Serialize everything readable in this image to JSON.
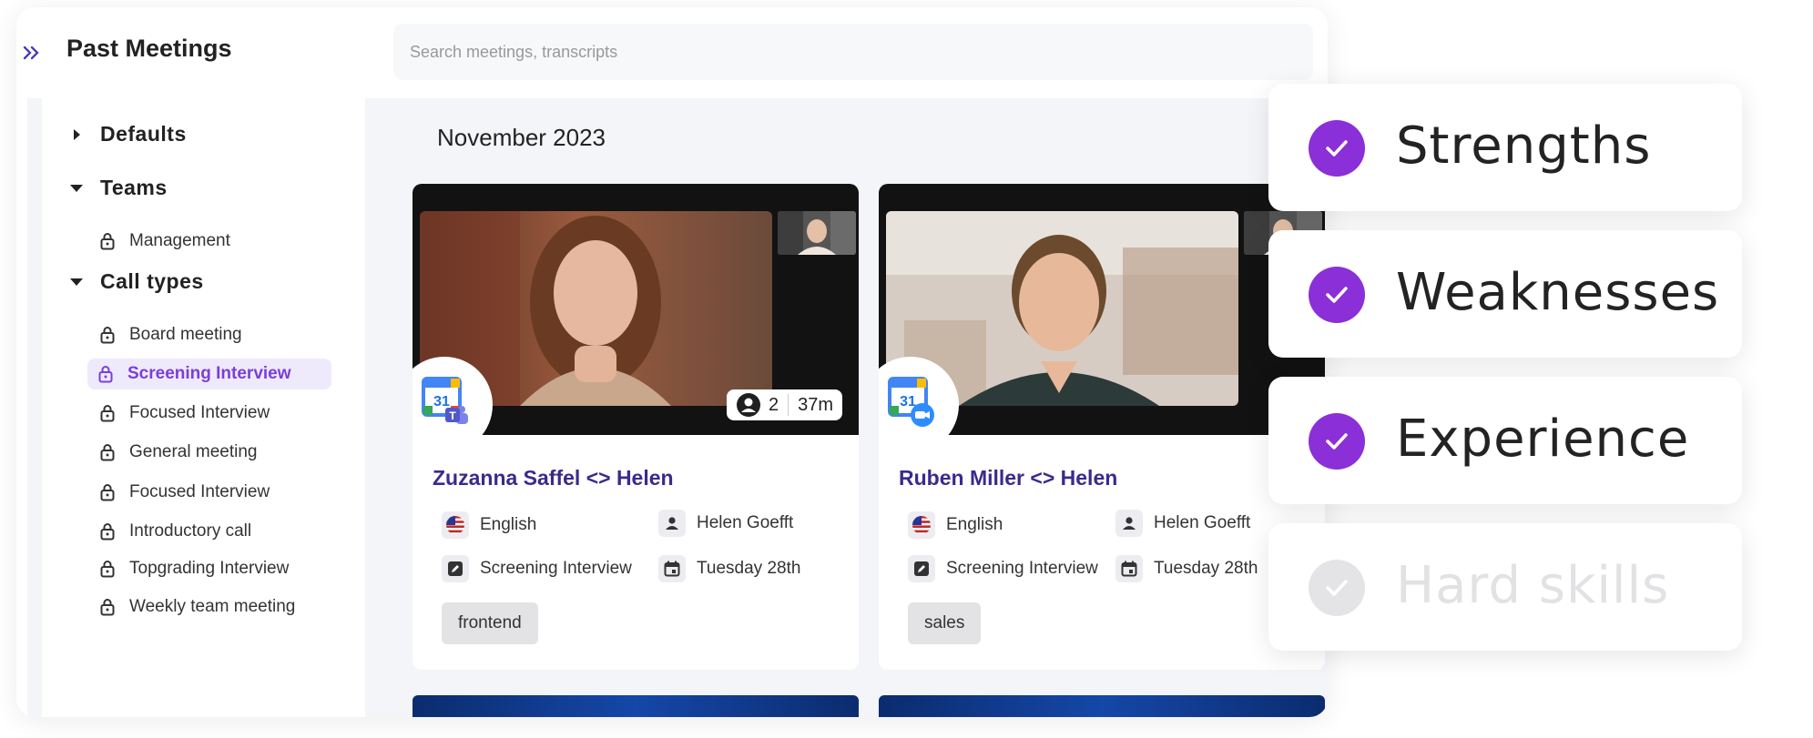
{
  "header": {
    "title": "Past Meetings",
    "search_placeholder": "Search meetings, transcripts"
  },
  "sidebar": {
    "sections": [
      {
        "label": "Defaults",
        "expanded": false
      },
      {
        "label": "Teams",
        "expanded": true
      },
      {
        "label": "Call types",
        "expanded": true
      }
    ],
    "teams_items": [
      "Management"
    ],
    "call_type_items": [
      "Board meeting",
      "Screening Interview",
      "Focused Interview",
      "General meeting",
      "Focused Interview",
      "Introductory call",
      "Topgrading Interview",
      "Weekly team meeting"
    ],
    "active_item": "Screening Interview"
  },
  "main": {
    "month": "November 2023",
    "cards": [
      {
        "title": "Zuzanna Saffel <> Helen",
        "language": "English",
        "host": "Helen Goefft",
        "call_type": "Screening Interview",
        "date": "Tuesday 28th",
        "tag": "frontend",
        "participants": "2",
        "duration": "37m"
      },
      {
        "title": "Ruben Miller <> Helen",
        "language": "English",
        "host": "Helen Goefft",
        "call_type": "Screening Interview",
        "date": "Tuesday 28th",
        "tag": "sales"
      }
    ]
  },
  "features": [
    {
      "label": "Strengths",
      "checked": true
    },
    {
      "label": "Weaknesses",
      "checked": true
    },
    {
      "label": "Experience",
      "checked": true
    },
    {
      "label": "Hard skills",
      "checked": false
    }
  ],
  "colors": {
    "accent": "#8b2fd8",
    "title_purple": "#3b2a8c",
    "active_bg": "#efe9fc"
  }
}
